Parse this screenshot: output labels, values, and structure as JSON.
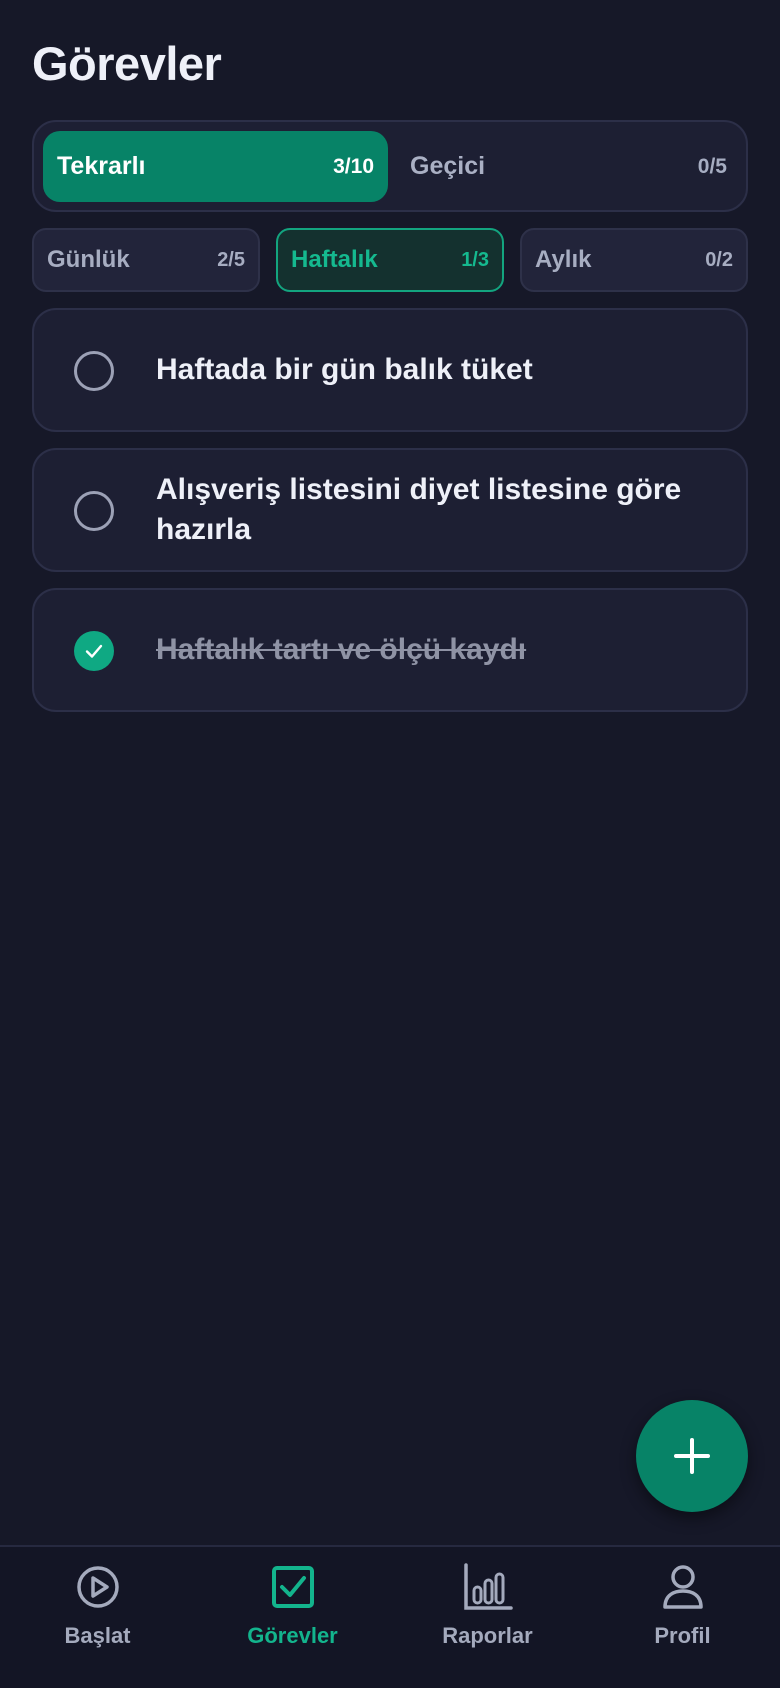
{
  "page": {
    "title": "Görevler"
  },
  "type_tabs": [
    {
      "label": "Tekrarlı",
      "count": "3/10",
      "active": true
    },
    {
      "label": "Geçici",
      "count": "0/5",
      "active": false
    }
  ],
  "period_tabs": [
    {
      "label": "Günlük",
      "count": "2/5",
      "active": false
    },
    {
      "label": "Haftalık",
      "count": "1/3",
      "active": true
    },
    {
      "label": "Aylık",
      "count": "0/2",
      "active": false
    }
  ],
  "tasks": [
    {
      "text": "Haftada bir gün balık tüket",
      "done": false
    },
    {
      "text": "Alışveriş listesini diyet listesine göre hazırla",
      "done": false
    },
    {
      "text": "Haftalık tartı ve ölçü kaydı",
      "done": true
    }
  ],
  "fab": {
    "icon": "plus-icon"
  },
  "bottom_nav": [
    {
      "label": "Başlat",
      "icon": "play-circle-icon",
      "active": false
    },
    {
      "label": "Görevler",
      "icon": "check-square-icon",
      "active": true
    },
    {
      "label": "Raporlar",
      "icon": "bar-chart-icon",
      "active": false
    },
    {
      "label": "Profil",
      "icon": "user-icon",
      "active": false
    }
  ],
  "colors": {
    "background": "#161828",
    "accent": "#078367",
    "accent_bright": "#13b48d",
    "card": "#1d1f33"
  }
}
